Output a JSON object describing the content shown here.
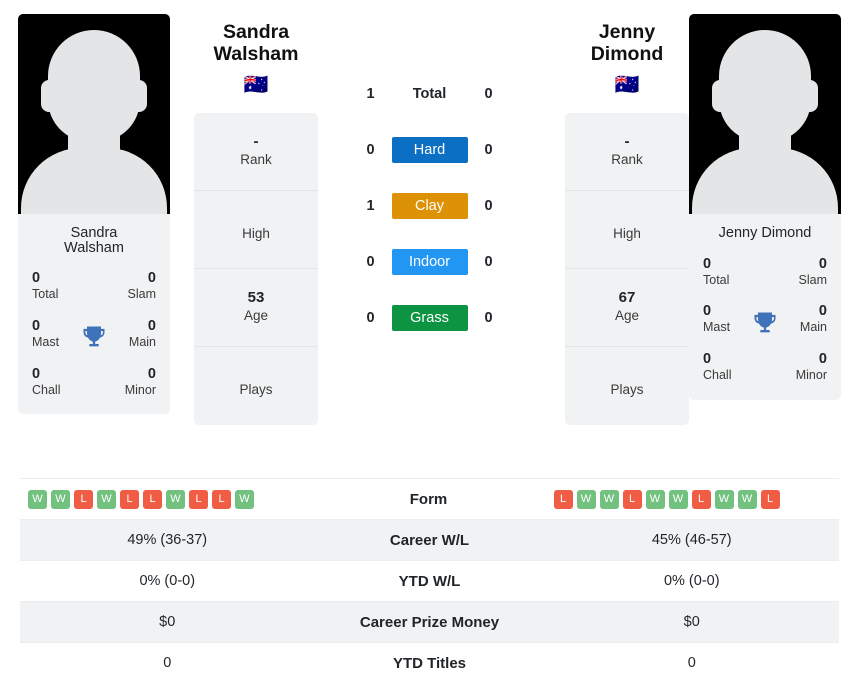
{
  "players": {
    "left": {
      "name_line1": "Sandra",
      "name_line2": "Walsham",
      "full_name": "Sandra Walsham",
      "flag": "🇦🇺",
      "flag_name": "australia-flag",
      "rank_value": "-",
      "rank_label": "Rank",
      "high_value": "",
      "high_label": "High",
      "age_value": "53",
      "age_label": "Age",
      "plays_value": "",
      "plays_label": "Plays",
      "titles": {
        "total_value": "0",
        "total_label": "Total",
        "slam_value": "0",
        "slam_label": "Slam",
        "mast_value": "0",
        "mast_label": "Mast",
        "main_value": "0",
        "main_label": "Main",
        "chall_value": "0",
        "chall_label": "Chall",
        "minor_value": "0",
        "minor_label": "Minor"
      },
      "form": [
        "W",
        "W",
        "L",
        "W",
        "L",
        "L",
        "W",
        "L",
        "L",
        "W"
      ],
      "career_wl": "49% (36-37)",
      "ytd_wl": "0% (0-0)",
      "career_prize": "$0",
      "ytd_titles": "0"
    },
    "right": {
      "name_line1": "Jenny Dimond",
      "name_line2": "",
      "full_name": "Jenny Dimond",
      "flag": "🇦🇺",
      "flag_name": "australia-flag",
      "rank_value": "-",
      "rank_label": "Rank",
      "high_value": "",
      "high_label": "High",
      "age_value": "67",
      "age_label": "Age",
      "plays_value": "",
      "plays_label": "Plays",
      "titles": {
        "total_value": "0",
        "total_label": "Total",
        "slam_value": "0",
        "slam_label": "Slam",
        "mast_value": "0",
        "mast_label": "Mast",
        "main_value": "0",
        "main_label": "Main",
        "chall_value": "0",
        "chall_label": "Chall",
        "minor_value": "0",
        "minor_label": "Minor"
      },
      "form": [
        "L",
        "W",
        "W",
        "L",
        "W",
        "W",
        "L",
        "W",
        "W",
        "L"
      ],
      "career_wl": "45% (46-57)",
      "ytd_wl": "0% (0-0)",
      "career_prize": "$0",
      "ytd_titles": "0"
    }
  },
  "surfaces": [
    {
      "label": "Total",
      "left": "1",
      "right": "0",
      "color": "",
      "text_color": "#212529",
      "style": "plain"
    },
    {
      "label": "Hard",
      "left": "0",
      "right": "0",
      "color": "#0b6fc4",
      "text_color": "#ffffff",
      "style": "badge"
    },
    {
      "label": "Clay",
      "left": "1",
      "right": "0",
      "color": "#dd9104",
      "text_color": "#ffffff",
      "style": "badge"
    },
    {
      "label": "Indoor",
      "left": "0",
      "right": "0",
      "color": "#2196f3",
      "text_color": "#ffffff",
      "style": "badge"
    },
    {
      "label": "Grass",
      "left": "0",
      "right": "0",
      "color": "#0d9442",
      "text_color": "#ffffff",
      "style": "badge"
    }
  ],
  "table_rows": [
    {
      "label": "Form",
      "type": "form"
    },
    {
      "label": "Career W/L",
      "type": "text",
      "left_key": "career_wl"
    },
    {
      "label": "YTD W/L",
      "type": "text",
      "left_key": "ytd_wl"
    },
    {
      "label": "Career Prize Money",
      "type": "text",
      "left_key": "career_prize"
    },
    {
      "label": "YTD Titles",
      "type": "text",
      "left_key": "ytd_titles"
    }
  ],
  "colors": {
    "win_badge": "#73c17e",
    "loss_badge": "#f05c44",
    "panel_bg": "#f1f2f3",
    "row_stripe": "#f1f2f3",
    "trophy": "#3f72b8"
  }
}
